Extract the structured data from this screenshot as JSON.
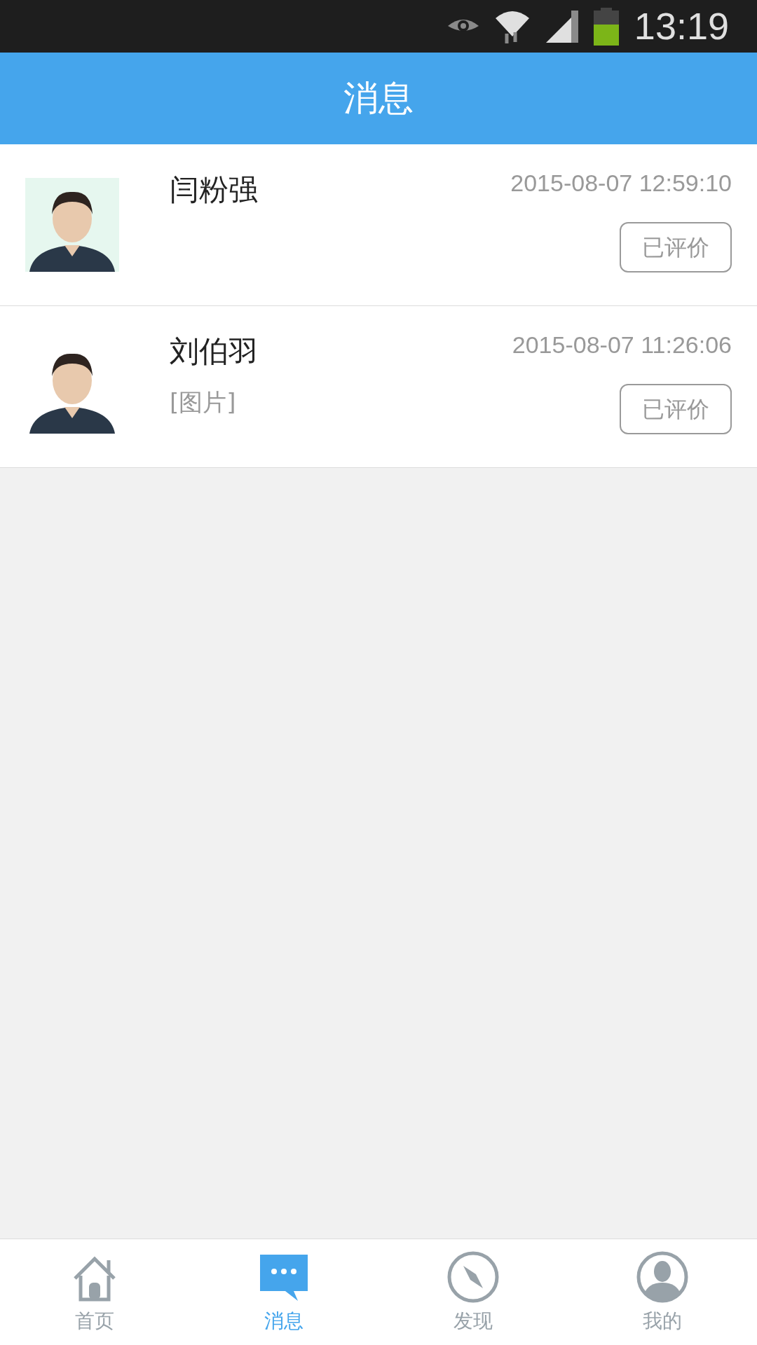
{
  "status_bar": {
    "time": "13:19"
  },
  "header": {
    "title": "消息"
  },
  "messages": [
    {
      "kind": "picture",
      "name": "闫粉强",
      "time": "2015-08-07 12:59:10",
      "action": "已评价"
    },
    {
      "kind": "picture",
      "name": "刘伯羽",
      "preview": "[图片]",
      "time": "2015-08-07 11:26:06",
      "action": "已评价"
    }
  ],
  "tabs": [
    {
      "label": "首页",
      "kind": "home",
      "selected": false
    },
    {
      "label": "消息",
      "kind": "chat",
      "selected": true
    },
    {
      "label": "发现",
      "kind": "compass",
      "selected": false
    },
    {
      "label": "我的",
      "kind": "person",
      "selected": false
    }
  ]
}
